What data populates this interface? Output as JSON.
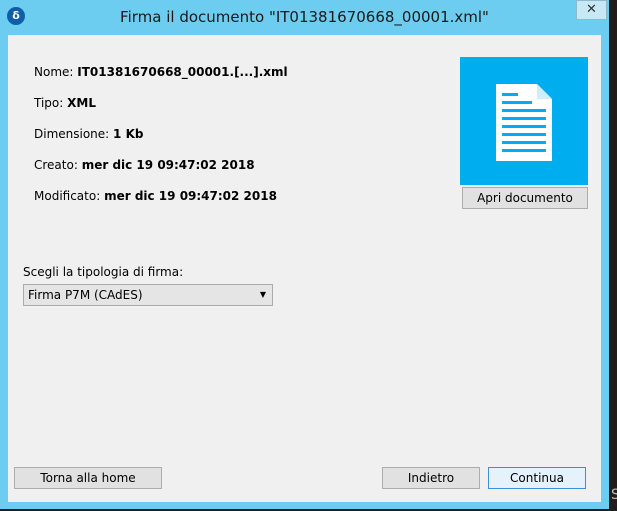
{
  "window": {
    "title": "Firma il documento \"IT01381670668_00001.xml\"",
    "app_icon_glyph": "δ",
    "close_glyph": "✕"
  },
  "document": {
    "name_label": "Nome:",
    "name_value": "IT01381670668_00001.[...].xml",
    "type_label": "Tipo:",
    "type_value": "XML",
    "size_label": "Dimensione:",
    "size_value": "1 Kb",
    "created_label": "Creato:",
    "created_value": "mer dic 19 09:47:02 2018",
    "modified_label": "Modificato:",
    "modified_value": "mer dic 19 09:47:02 2018",
    "thumbnail_icon": "document-icon",
    "open_button": "Apri documento"
  },
  "signature": {
    "label": "Scegli la tipologia di firma:",
    "selected": "Firma P7M (CAdES)"
  },
  "footer": {
    "home_button": "Torna alla home",
    "back_button": "Indietro",
    "continue_button": "Continua"
  },
  "backdrop_glyph": "S",
  "colors": {
    "titlebar": "#6ccdf0",
    "accent": "#00aeef",
    "client_bg": "#f0f0f0"
  }
}
